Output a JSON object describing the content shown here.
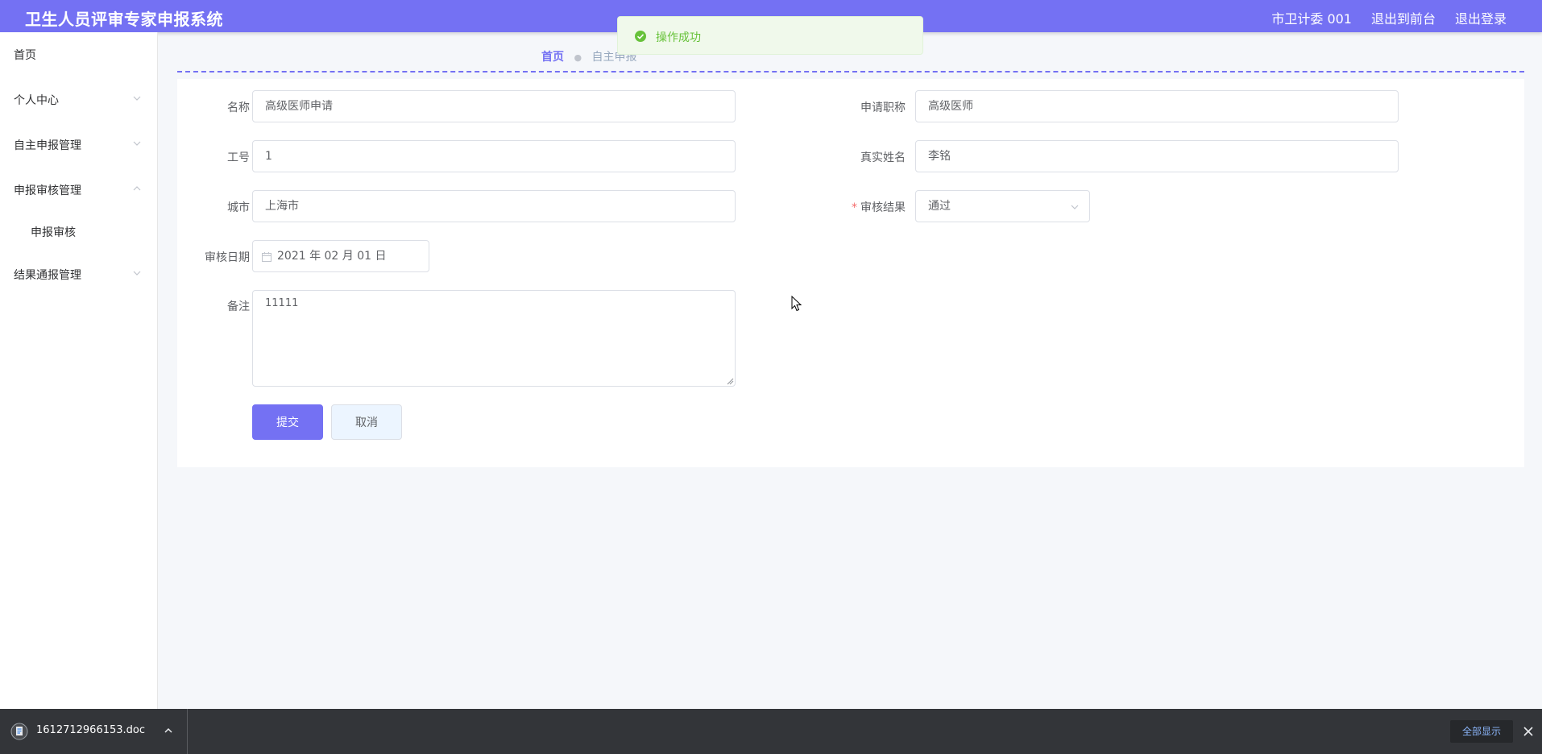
{
  "header": {
    "title": "卫生人员评审专家申报系统",
    "user": "市卫计委 001",
    "front_link": "退出到前台",
    "logout_link": "退出登录",
    "brand_color": "#7471f3"
  },
  "sidebar": {
    "items": [
      {
        "label": "首页"
      },
      {
        "label": "个人中心",
        "icon": "chevron-down-icon"
      },
      {
        "label": "自主申报管理",
        "icon": "chevron-down-icon"
      },
      {
        "label": "申报审核管理",
        "icon": "chevron-up-icon"
      },
      {
        "label": "申报审核"
      },
      {
        "label": "结果通报管理",
        "icon": "chevron-down-icon"
      }
    ]
  },
  "toast": {
    "message": "操作成功",
    "icon": "success-check-icon",
    "color": "#67c23a"
  },
  "breadcrumb": {
    "home": "首页",
    "current": "自主申报"
  },
  "form": {
    "name_label": "名称",
    "name_value": "高级医师申请",
    "title_label": "申请职称",
    "title_value": "高级医师",
    "job_no_label": "工号",
    "job_no_value": "1",
    "real_name_label": "真实姓名",
    "real_name_value": "李铭",
    "city_label": "城市",
    "city_value": "上海市",
    "result_label": "审核结果",
    "result_value": "通过",
    "date_label": "审核日期",
    "date_value": "2021 年 02 月 01 日",
    "remark_label": "备注",
    "remark_value": "11111",
    "submit_label": "提交",
    "cancel_label": "取消"
  },
  "download_bar": {
    "file_name": "1612712966153.doc",
    "show_all": "全部显示"
  }
}
